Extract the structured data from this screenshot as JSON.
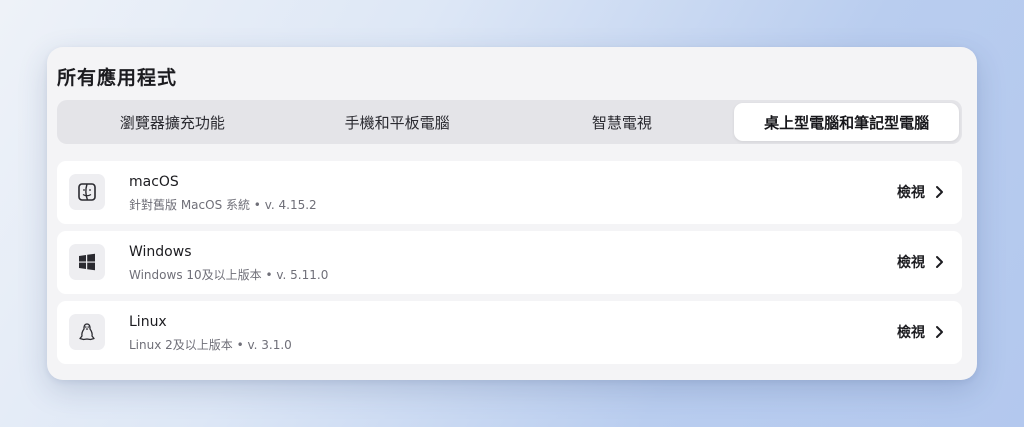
{
  "panel": {
    "title": "所有應用程式"
  },
  "tabs": [
    {
      "label": "瀏覽器擴充功能",
      "active": false
    },
    {
      "label": "手機和平板電腦",
      "active": false
    },
    {
      "label": "智慧電視",
      "active": false
    },
    {
      "label": "桌上型電腦和筆記型電腦",
      "active": true
    }
  ],
  "apps": [
    {
      "name": "macOS",
      "subtitle": "針對舊版 MacOS 系統 • v. 4.15.2",
      "icon": "finder-icon",
      "action": "檢視"
    },
    {
      "name": "Windows",
      "subtitle": "Windows 10及以上版本 • v. 5.11.0",
      "icon": "windows-icon",
      "action": "檢視"
    },
    {
      "name": "Linux",
      "subtitle": "Linux 2及以上版本 • v. 3.1.0",
      "icon": "linux-tux-icon",
      "action": "檢視"
    }
  ]
}
